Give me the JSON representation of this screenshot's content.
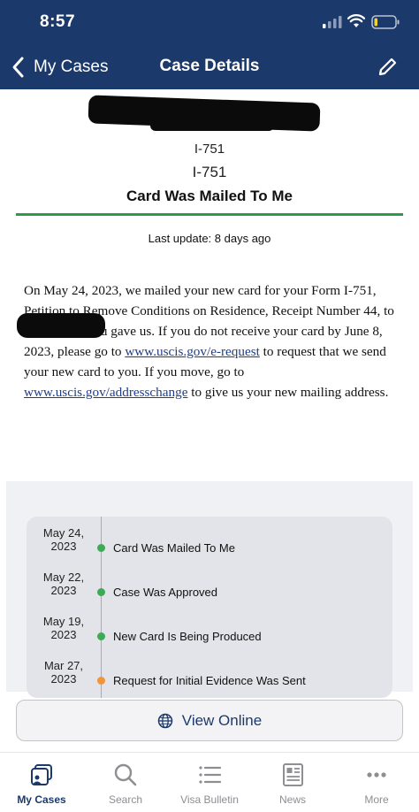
{
  "status_bar": {
    "time": "8:57"
  },
  "nav": {
    "back_label": "My Cases",
    "title": "Case Details"
  },
  "case": {
    "form_line_1": "I-751",
    "form_line_2": "I-751",
    "status_title": "Card Was Mailed To Me",
    "last_update": "Last update: 8 days ago"
  },
  "description": {
    "part1": "On May 24, 2023, we mailed your new card for your Form I-751, Petition to Remove Conditions on Residence, Receipt Number ",
    "part1_tail": "44, to the address you gave us. If you do not receive your card by June 8, 2023, please go to ",
    "link1": "www.uscis.gov/e-request",
    "part2": " to request that we send your new card to you. If you move, go to ",
    "link2": "www.uscis.gov/addresschange",
    "part3": " to give us your new mailing address."
  },
  "timeline": [
    {
      "date_line1": "May 24,",
      "date_line2": "2023",
      "label": "Card Was Mailed To Me",
      "color": "#3daa55"
    },
    {
      "date_line1": "May 22,",
      "date_line2": "2023",
      "label": "Case Was Approved",
      "color": "#3daa55"
    },
    {
      "date_line1": "May 19,",
      "date_line2": "2023",
      "label": "New Card Is Being Produced",
      "color": "#3daa55"
    },
    {
      "date_line1": "Mar 27,",
      "date_line2": "2023",
      "label": "Request for Initial Evidence Was Sent",
      "color": "#f0953a"
    }
  ],
  "view_online": {
    "label": "View Online"
  },
  "tabs": [
    {
      "label": "My Cases",
      "icon": "cases-icon",
      "active": true
    },
    {
      "label": "Search",
      "icon": "search-icon",
      "active": false
    },
    {
      "label": "Visa Bulletin",
      "icon": "list-icon",
      "active": false
    },
    {
      "label": "News",
      "icon": "newspaper-icon",
      "active": false
    },
    {
      "label": "More",
      "icon": "more-icon",
      "active": false
    }
  ],
  "colors": {
    "header": "#1b3a6b",
    "accent_green": "#2e9b48",
    "link": "#1f3d8a"
  }
}
